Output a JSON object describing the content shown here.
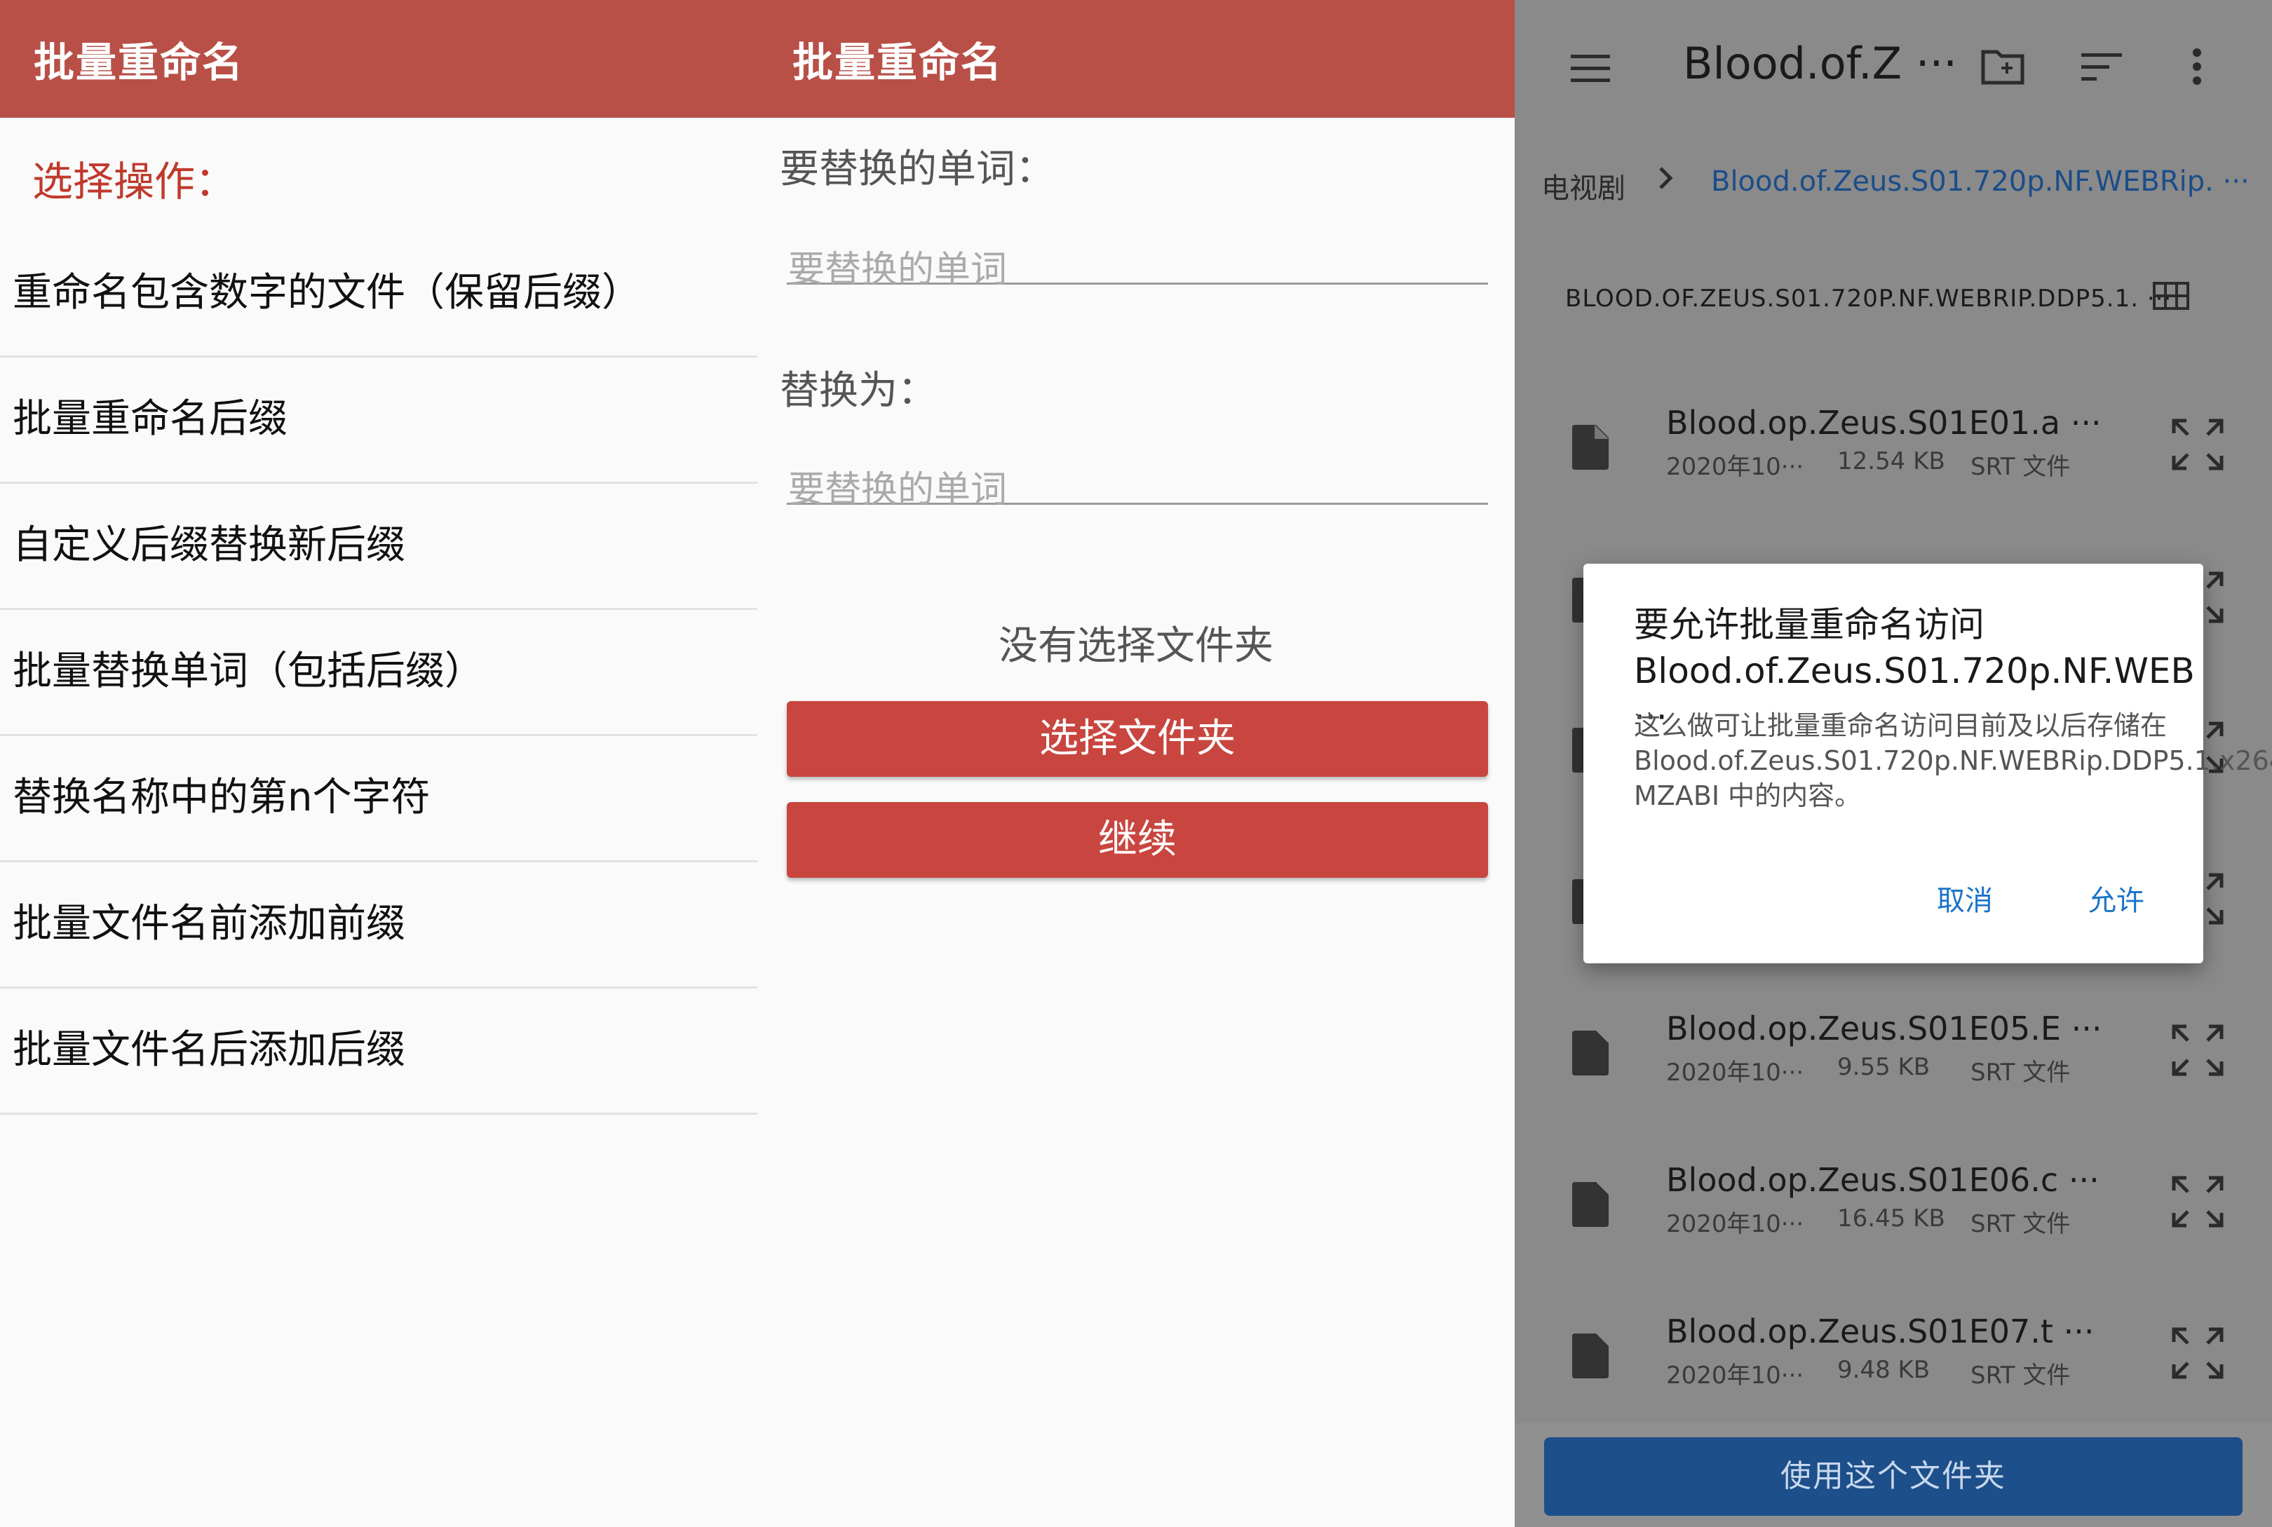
{
  "panel1": {
    "app_title": "批量重命名",
    "section_title": "选择操作：",
    "operations": [
      "重命名包含数字的文件（保留后缀）",
      "批量重命名后缀",
      "自定义后缀替换新后缀",
      "批量替换单词（包括后缀）",
      "替换名称中的第n个字符",
      "批量文件名前添加前缀",
      "批量文件名后添加后缀"
    ]
  },
  "panel2": {
    "app_title": "批量重命名",
    "find_label": "要替换的单词：",
    "find_placeholder": "要替换的单词",
    "replace_label": "替换为：",
    "replace_placeholder": "要替换的单词",
    "no_folder_text": "没有选择文件夹",
    "choose_folder_button": "选择文件夹",
    "continue_button": "继续"
  },
  "panel3": {
    "title": "Blood.of.Z ···",
    "breadcrumb_root": "电视剧",
    "breadcrumb_current": "Blood.of.Zeus.S01.720p.NF.WEBRip. ···",
    "folder_name": "BLOOD.OF.ZEUS.S01.720P.NF.WEBRIP.DDP5.1. ···",
    "files": [
      {
        "name": "Blood.op.Zeus.S01E01.a ···",
        "date": "2020年10···",
        "size": "12.54 KB",
        "type": "SRT 文件"
      },
      {
        "name": "Blood.op.Zeus.S01E05.E ···",
        "date": "2020年10···",
        "size": "9.55 KB",
        "type": "SRT 文件"
      },
      {
        "name": "Blood.op.Zeus.S01E06.c ···",
        "date": "2020年10···",
        "size": "16.45 KB",
        "type": "SRT 文件"
      },
      {
        "name": "Blood.op.Zeus.S01E07.t ···",
        "date": "2020年10···",
        "size": "9.48 KB",
        "type": "SRT 文件"
      }
    ],
    "use_folder_button": "使用这个文件夹",
    "dialog": {
      "title": "要允许批量重命名访问 Blood.of.Zeus.S01.720p.NF.WEB ···",
      "body": "这么做可让批量重命名访问目前及以后存储在 Blood.of.Zeus.S01.720p.NF.WEBRip.DDP5.1.x264-MZABI 中的内容。",
      "cancel": "取消",
      "allow": "允许"
    },
    "icons": [
      "menu-icon",
      "new-folder-icon",
      "sort-icon",
      "more-vert-icon",
      "chevron-right-icon",
      "grid-view-icon",
      "file-icon",
      "expand-icon"
    ]
  },
  "colors": {
    "appbar": "#b85048",
    "accent_red": "#c8463f",
    "section_title": "#c0392b",
    "picker_button": "#1d4f8a",
    "dialog_action": "#1a73c8"
  }
}
